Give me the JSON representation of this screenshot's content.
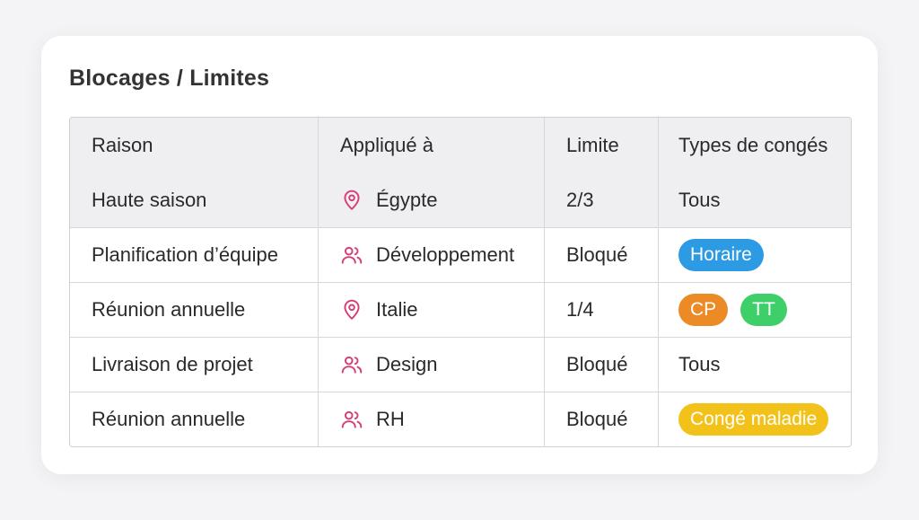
{
  "title": "Blocages / Limites",
  "headers": [
    "Raison",
    "Appliqué à",
    "Limite",
    "Types de congés"
  ],
  "rows": [
    {
      "raison": "Haute saison",
      "applique": "Égypte",
      "icon": "location-pin-icon",
      "limite": "2/3",
      "types_text": "Tous",
      "tags": []
    },
    {
      "raison": "Planification d’équipe",
      "applique": "Développement",
      "icon": "users-icon",
      "limite": "Bloqué",
      "types_text": "",
      "tags": [
        {
          "label": "Horaire",
          "color": "#2c9be3"
        }
      ]
    },
    {
      "raison": "Réunion annuelle",
      "applique": "Italie",
      "icon": "location-pin-icon",
      "limite": "1/4",
      "types_text": "",
      "tags": [
        {
          "label": "CP",
          "color": "#ec8b25"
        },
        {
          "label": "TT",
          "color": "#3fcf68"
        }
      ]
    },
    {
      "raison": "Livraison de projet",
      "applique": "Design",
      "icon": "users-icon",
      "limite": "Bloqué",
      "types_text": "Tous",
      "tags": []
    },
    {
      "raison": "Réunion annuelle",
      "applique": "RH",
      "icon": "users-icon",
      "limite": "Bloqué",
      "types_text": "",
      "tags": [
        {
          "label": "Congé maladie",
          "color": "#f3c21a"
        }
      ]
    }
  ],
  "colors": {
    "icon": "#d43f78"
  }
}
